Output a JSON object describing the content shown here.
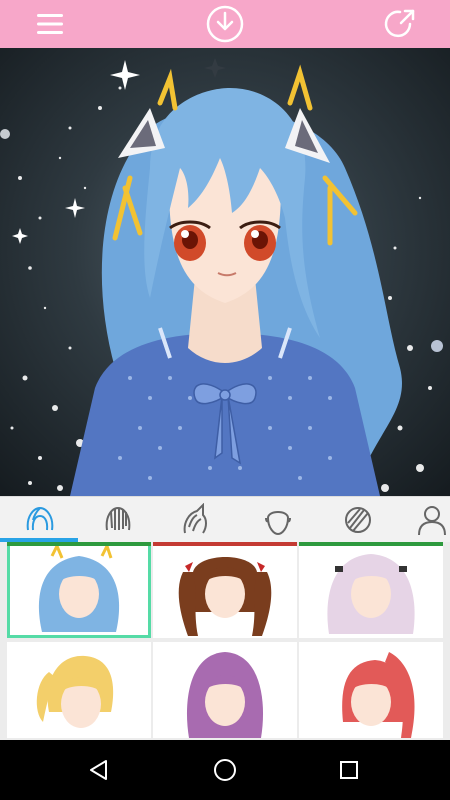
{
  "topbar": {
    "background": "#f7a7c9",
    "icons": [
      "menu-icon",
      "download-icon",
      "share-icon"
    ]
  },
  "canvas": {
    "hair_color": "#7fb4e3",
    "eye_color": "#d14a2a",
    "ribbon_color": "#f2c233",
    "shirt_color": "#5376c2"
  },
  "tabs": {
    "items": [
      {
        "icon": "hair-icon",
        "selected": true
      },
      {
        "icon": "back-hair-icon",
        "selected": false
      },
      {
        "icon": "ear-accessory-icon",
        "selected": false
      },
      {
        "icon": "face-icon",
        "selected": false
      },
      {
        "icon": "hair-texture-icon",
        "selected": false
      },
      {
        "icon": "body-icon",
        "selected": false
      }
    ],
    "indicator_color": "#29a3e6"
  },
  "hair_options": [
    {
      "color": "#7fb4e3",
      "tag": "green",
      "selected": true,
      "accessory": "ribbon"
    },
    {
      "color": "#7a3d1e",
      "tag": "red",
      "selected": false,
      "accessory": "bows"
    },
    {
      "color": "#e6d4e6",
      "tag": "green",
      "selected": false,
      "accessory": "clips"
    },
    {
      "color": "#f3cf6a",
      "tag": "",
      "selected": false,
      "accessory": "ponytail"
    },
    {
      "color": "#a86bb0",
      "tag": "",
      "selected": false,
      "accessory": "twin-tails"
    },
    {
      "color": "#e25a58",
      "tag": "",
      "selected": false,
      "accessory": "high-ponytail"
    }
  ],
  "tag_colors": {
    "green": "#2e9a3e",
    "red": "#c43a33"
  },
  "navbar": {
    "icons": [
      "back-icon",
      "home-icon",
      "recents-icon"
    ]
  }
}
